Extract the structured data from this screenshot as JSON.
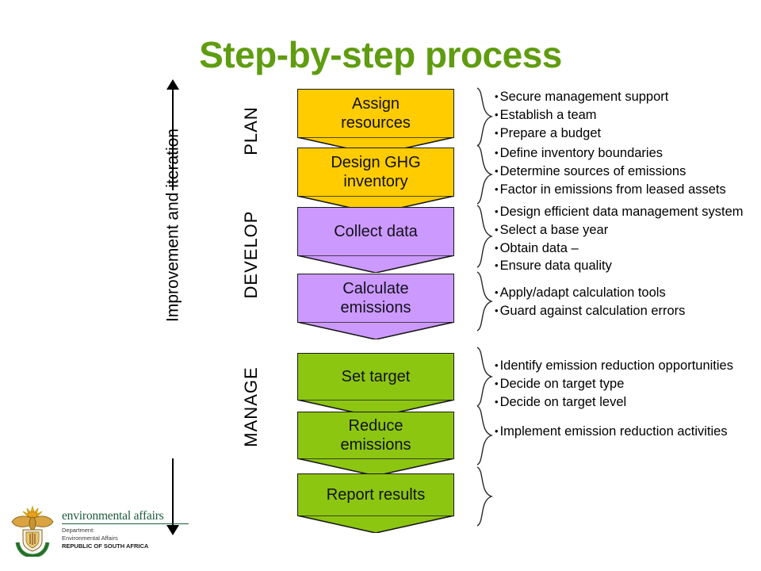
{
  "slide": {
    "title": "Step-by-step process",
    "title_color": "#5f9c10",
    "background": "#ffffff"
  },
  "axis": {
    "label": "Improvement and iteration",
    "arrow": "double-headed-vertical-arrow"
  },
  "phases": [
    {
      "label": "PLAN",
      "color": "#ffcc00"
    },
    {
      "label": "DEVELOP",
      "color": "#cc99ff"
    },
    {
      "label": "MANAGE",
      "color": "#8cc611"
    }
  ],
  "steps": [
    {
      "label_line1": "Assign",
      "label_line2": "resources",
      "color": "#ffcc00",
      "phase": "PLAN",
      "bullets": [
        "Secure management support",
        "Establish a team",
        "Prepare a budget"
      ]
    },
    {
      "label_line1": "Design GHG",
      "label_line2": "inventory",
      "color": "#ffcc00",
      "phase": "PLAN",
      "bullets": [
        "Define inventory boundaries",
        "Determine sources of emissions",
        "Factor in emissions from leased assets"
      ]
    },
    {
      "label_line1": "Collect data",
      "label_line2": "",
      "color": "#cc99ff",
      "phase": "DEVELOP",
      "bullets": [
        "Design efficient data management system",
        "Select a base year",
        "Obtain data –",
        "Ensure data quality"
      ]
    },
    {
      "label_line1": "Calculate",
      "label_line2": "emissions",
      "color": "#cc99ff",
      "phase": "DEVELOP",
      "bullets": [
        "Apply/adapt calculation tools",
        "Guard against calculation errors"
      ]
    },
    {
      "label_line1": "Set target",
      "label_line2": "",
      "color": "#8cc611",
      "phase": "MANAGE",
      "bullets": [
        "Identify emission reduction opportunities",
        "Decide on target type",
        "Decide on target level"
      ]
    },
    {
      "label_line1": "Reduce",
      "label_line2": "emissions",
      "color": "#8cc611",
      "phase": "MANAGE",
      "bullets": [
        "Implement emission reduction activities"
      ]
    },
    {
      "label_line1": "Report results",
      "label_line2": "",
      "color": "#8cc611",
      "phase": "MANAGE",
      "bullets": []
    }
  ],
  "logo": {
    "title": "environmental affairs",
    "line1": "Department:",
    "line2": "Environmental Affairs",
    "line3": "REPUBLIC OF SOUTH AFRICA",
    "emblem": "south-africa-coat-of-arms"
  }
}
